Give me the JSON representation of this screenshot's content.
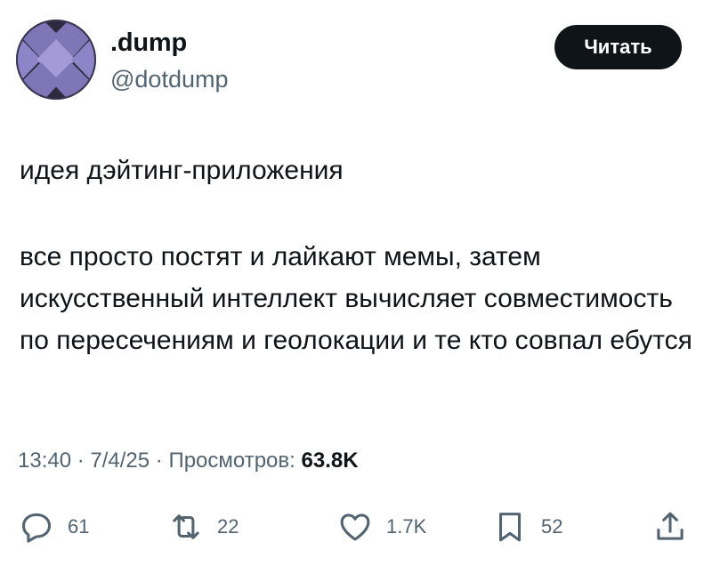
{
  "author": {
    "display_name": ".dump",
    "handle": "@dotdump"
  },
  "read_button_label": "Читать",
  "tweet": {
    "line_1": "идея дэйтинг-приложения",
    "line_2": "все просто постят и лайкают мемы, затем искусственный интеллект вычисляет совместимость по пересечениям и геолокации и те кто совпал ебутся"
  },
  "meta": {
    "time": "13:40",
    "separator_1": " · ",
    "date": "7/4/25",
    "separator_2": " · ",
    "views_label": "Просмотров: ",
    "views_count": "63.8K"
  },
  "actions": {
    "replies": "61",
    "reposts": "22",
    "likes": "1.7K",
    "bookmarks": "52"
  },
  "icons": {
    "reply": "reply-icon",
    "repost": "repost-icon",
    "like": "heart-icon",
    "bookmark": "bookmark-icon",
    "share": "share-icon"
  },
  "colors": {
    "text_primary": "#0f1419",
    "text_secondary": "#536471",
    "button_background": "#0f1419",
    "button_text": "#ffffff",
    "avatar_base": "#2e2a3e",
    "avatar_accent": "#8e84c8"
  }
}
